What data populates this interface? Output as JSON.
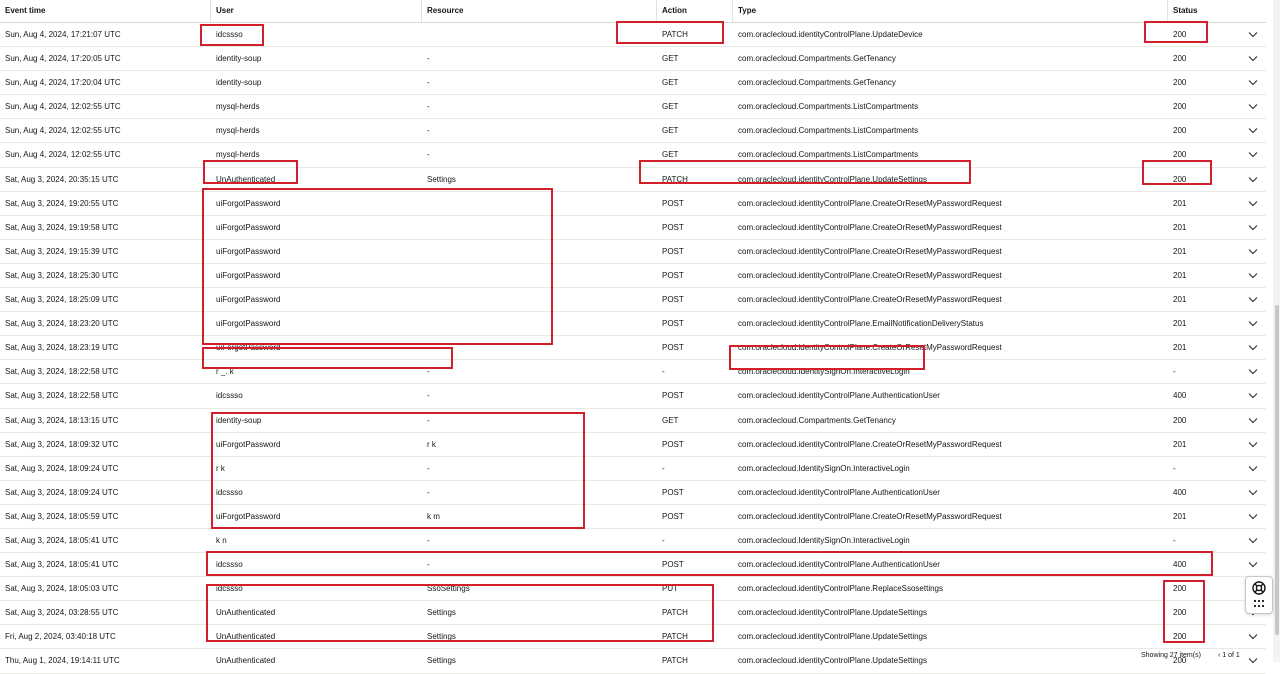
{
  "columns": {
    "event_time": "Event time",
    "user": "User",
    "resource": "Resource",
    "action": "Action",
    "type": "Type",
    "status": "Status"
  },
  "rows": [
    {
      "time": "Sun, Aug 4, 2024, 17:21:07 UTC",
      "user": "idcssso",
      "resource": "",
      "action": "PATCH",
      "type": "com.oraclecloud.identityControlPlane.UpdateDevice",
      "status": "200"
    },
    {
      "time": "Sun, Aug 4, 2024, 17:20:05 UTC",
      "user": "identity-soup",
      "resource": "-",
      "action": "GET",
      "type": "com.oraclecloud.Compartments.GetTenancy",
      "status": "200"
    },
    {
      "time": "Sun, Aug 4, 2024, 17:20:04 UTC",
      "user": "identity-soup",
      "resource": "-",
      "action": "GET",
      "type": "com.oraclecloud.Compartments.GetTenancy",
      "status": "200"
    },
    {
      "time": "Sun, Aug 4, 2024, 12:02:55 UTC",
      "user": "mysql-herds",
      "resource": "-",
      "action": "GET",
      "type": "com.oraclecloud.Compartments.ListCompartments",
      "status": "200"
    },
    {
      "time": "Sun, Aug 4, 2024, 12:02:55 UTC",
      "user": "mysql-herds",
      "resource": "-",
      "action": "GET",
      "type": "com.oraclecloud.Compartments.ListCompartments",
      "status": "200"
    },
    {
      "time": "Sun, Aug 4, 2024, 12:02:55 UTC",
      "user": "mysql-herds",
      "resource": "-",
      "action": "GET",
      "type": "com.oraclecloud.Compartments.ListCompartments",
      "status": "200"
    },
    {
      "time": "Sat, Aug 3, 2024, 20:35:15 UTC",
      "user": "UnAuthenticated",
      "resource": "Settings",
      "action": "PATCH",
      "type": "com.oraclecloud.identityControlPlane.UpdateSettings",
      "status": "200"
    },
    {
      "time": "Sat, Aug 3, 2024, 19:20:55 UTC",
      "user": "uiForgotPassword",
      "resource": "",
      "action": "POST",
      "type": "com.oraclecloud.identityControlPlane.CreateOrResetMyPasswordRequest",
      "status": "201"
    },
    {
      "time": "Sat, Aug 3, 2024, 19:19:58 UTC",
      "user": "uiForgotPassword",
      "resource": "",
      "action": "POST",
      "type": "com.oraclecloud.identityControlPlane.CreateOrResetMyPasswordRequest",
      "status": "201"
    },
    {
      "time": "Sat, Aug 3, 2024, 19:15:39 UTC",
      "user": "uiForgotPassword",
      "resource": "",
      "action": "POST",
      "type": "com.oraclecloud.identityControlPlane.CreateOrResetMyPasswordRequest",
      "status": "201"
    },
    {
      "time": "Sat, Aug 3, 2024, 18:25:30 UTC",
      "user": "uiForgotPassword",
      "resource": "",
      "action": "POST",
      "type": "com.oraclecloud.identityControlPlane.CreateOrResetMyPasswordRequest",
      "status": "201"
    },
    {
      "time": "Sat, Aug 3, 2024, 18:25:09 UTC",
      "user": "uiForgotPassword",
      "resource": "",
      "action": "POST",
      "type": "com.oraclecloud.identityControlPlane.CreateOrResetMyPasswordRequest",
      "status": "201"
    },
    {
      "time": "Sat, Aug 3, 2024, 18:23:20 UTC",
      "user": "uiForgotPassword",
      "resource": "",
      "action": "POST",
      "type": "com.oraclecloud.identityControlPlane.EmailNotificationDeliveryStatus",
      "status": "201"
    },
    {
      "time": "Sat, Aug 3, 2024, 18:23:19 UTC",
      "user": "uiForgotPassword",
      "resource": "",
      "action": "POST",
      "type": "com.oraclecloud.identityControlPlane.CreateOrResetMyPasswordRequest",
      "status": "201"
    },
    {
      "time": "Sat, Aug 3, 2024, 18:22:58 UTC",
      "user": "r                    _.               k",
      "resource": "-",
      "action": "-",
      "type": "com.oraclecloud.IdentitySignOn.InteractiveLogin",
      "status": "-"
    },
    {
      "time": "Sat, Aug 3, 2024, 18:22:58 UTC",
      "user": "idcssso",
      "resource": "-",
      "action": "POST",
      "type": "com.oraclecloud.identityControlPlane.AuthenticationUser",
      "status": "400"
    },
    {
      "time": "Sat, Aug 3, 2024, 18:13:15 UTC",
      "user": "identity-soup",
      "resource": "-",
      "action": "GET",
      "type": "com.oraclecloud.Compartments.GetTenancy",
      "status": "200"
    },
    {
      "time": "Sat, Aug 3, 2024, 18:09:32 UTC",
      "user": "uiForgotPassword",
      "resource": "r                                             k",
      "action": "POST",
      "type": "com.oraclecloud.identityControlPlane.CreateOrResetMyPasswordRequest",
      "status": "201"
    },
    {
      "time": "Sat, Aug 3, 2024, 18:09:24 UTC",
      "user": "r                                      k",
      "resource": "-",
      "action": "-",
      "type": "com.oraclecloud.IdentitySignOn.InteractiveLogin",
      "status": "-"
    },
    {
      "time": "Sat, Aug 3, 2024, 18:09:24 UTC",
      "user": "idcssso",
      "resource": "-",
      "action": "POST",
      "type": "com.oraclecloud.identityControlPlane.AuthenticationUser",
      "status": "400"
    },
    {
      "time": "Sat, Aug 3, 2024, 18:05:59 UTC",
      "user": "uiForgotPassword",
      "resource": "k                                        m",
      "action": "POST",
      "type": "com.oraclecloud.identityControlPlane.CreateOrResetMyPasswordRequest",
      "status": "201"
    },
    {
      "time": "Sat, Aug 3, 2024, 18:05:41 UTC",
      "user": "k                               n",
      "resource": "-",
      "action": "-",
      "type": "com.oraclecloud.IdentitySignOn.InteractiveLogin",
      "status": "-"
    },
    {
      "time": "Sat, Aug 3, 2024, 18:05:41 UTC",
      "user": "idcssso",
      "resource": "-",
      "action": "POST",
      "type": "com.oraclecloud.identityControlPlane.AuthenticationUser",
      "status": "400"
    },
    {
      "time": "Sat, Aug 3, 2024, 18:05:03 UTC",
      "user": "idcssso",
      "resource": "SsoSettings",
      "action": "PUT",
      "type": "com.oraclecloud.identityControlPlane.ReplaceSsosettings",
      "status": "200"
    },
    {
      "time": "Sat, Aug 3, 2024, 03:28:55 UTC",
      "user": "UnAuthenticated",
      "resource": "Settings",
      "action": "PATCH",
      "type": "com.oraclecloud.identityControlPlane.UpdateSettings",
      "status": "200"
    },
    {
      "time": "Fri, Aug 2, 2024, 03:40:18 UTC",
      "user": "UnAuthenticated",
      "resource": "Settings",
      "action": "PATCH",
      "type": "com.oraclecloud.identityControlPlane.UpdateSettings",
      "status": "200"
    },
    {
      "time": "Thu, Aug 1, 2024, 19:14:11 UTC",
      "user": "UnAuthenticated",
      "resource": "Settings",
      "action": "PATCH",
      "type": "com.oraclecloud.identityControlPlane.UpdateSettings",
      "status": "200"
    }
  ],
  "footer": {
    "showing": "Showing 27 item(s)",
    "pager": "1 of 1"
  },
  "colors": {
    "highlight": "#d1202a",
    "divider": "#ebe9e5"
  },
  "icons": {
    "row_expand": "chevron-down-icon",
    "help": "lifebuoy-icon",
    "apps": "grid-dots-icon"
  }
}
